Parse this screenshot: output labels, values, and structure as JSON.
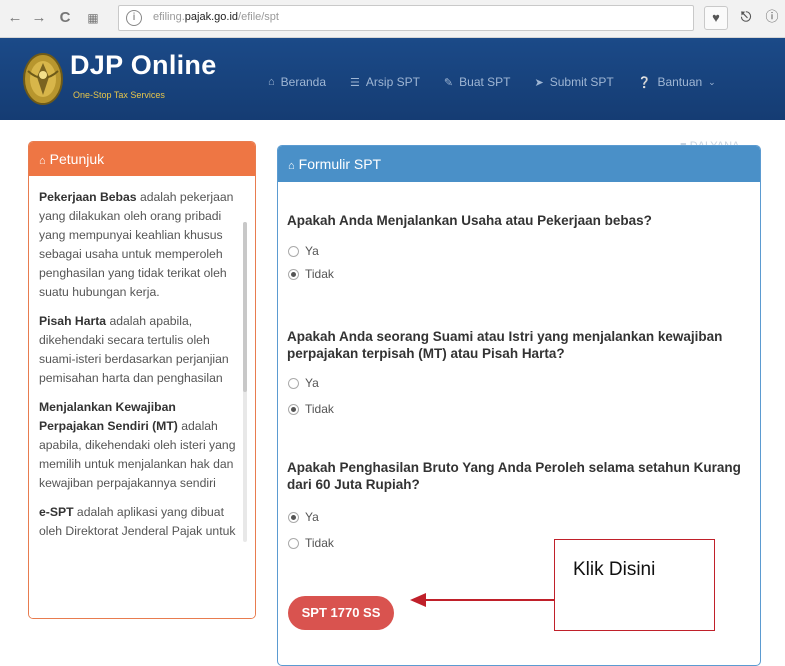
{
  "browser": {
    "url_prefix": "efiling.",
    "url_domain": "pajak.go.id",
    "url_path": "/efile/spt",
    "back_icon": "back-arrow-icon",
    "forward_icon": "forward-arrow-icon",
    "reload_icon": "reload-icon",
    "apps_icon": "apps-grid-icon"
  },
  "header": {
    "title": "DJP Online",
    "subtitle": "One-Stop Tax Services",
    "nav": [
      {
        "label": "Beranda",
        "icon": "home-icon"
      },
      {
        "label": "Arsip SPT",
        "icon": "list-icon"
      },
      {
        "label": "Buat SPT",
        "icon": "edit-icon"
      },
      {
        "label": "Submit SPT",
        "icon": "send-icon"
      },
      {
        "label": "Bantuan",
        "icon": "help-icon"
      }
    ],
    "user": "DALYANA"
  },
  "petunjuk": {
    "title": "Petunjuk",
    "items": [
      {
        "term": "Pekerjaan Bebas",
        "text": " adalah pekerjaan yang dilakukan oleh orang pribadi yang mempunyai keahlian khusus sebagai usaha untuk memperoleh penghasilan yang tidak terikat oleh suatu hubungan kerja."
      },
      {
        "term": "Pisah Harta",
        "text": " adalah apabila, dikehendaki secara tertulis oleh suami-isteri berdasarkan perjanjian pemisahan harta dan penghasilan"
      },
      {
        "term": "Menjalankan Kewajiban Perpajakan Sendiri (MT)",
        "text": " adalah apabila, dikehendaki oleh isteri yang memilih untuk menjalankan hak dan kewajiban perpajakannya sendiri"
      },
      {
        "term": "e-SPT",
        "text": " adalah aplikasi yang dibuat oleh Direktorat Jenderal Pajak untuk"
      }
    ]
  },
  "form": {
    "title": "Formulir SPT",
    "questions": [
      {
        "text": "Apakah Anda Menjalankan Usaha atau Pekerjaan bebas?",
        "options": [
          "Ya",
          "Tidak"
        ],
        "selected": "Tidak"
      },
      {
        "text": "Apakah Anda seorang Suami atau Istri yang menjalankan kewajiban perpajakan terpisah (MT) atau Pisah Harta?",
        "options": [
          "Ya",
          "Tidak"
        ],
        "selected": "Tidak"
      },
      {
        "text": "Apakah Penghasilan Bruto Yang Anda Peroleh selama setahun Kurang dari 60 Juta Rupiah?",
        "options": [
          "Ya",
          "Tidak"
        ],
        "selected": "Ya"
      }
    ],
    "button_label": "SPT 1770 SS"
  },
  "annotation": {
    "text": "Klik Disini",
    "border_color": "#c0202a"
  },
  "colors": {
    "header_blue": "#1b4a88",
    "petunjuk_orange": "#ee7644",
    "formulir_blue": "#4a90c8",
    "button_red": "#d9534f"
  }
}
